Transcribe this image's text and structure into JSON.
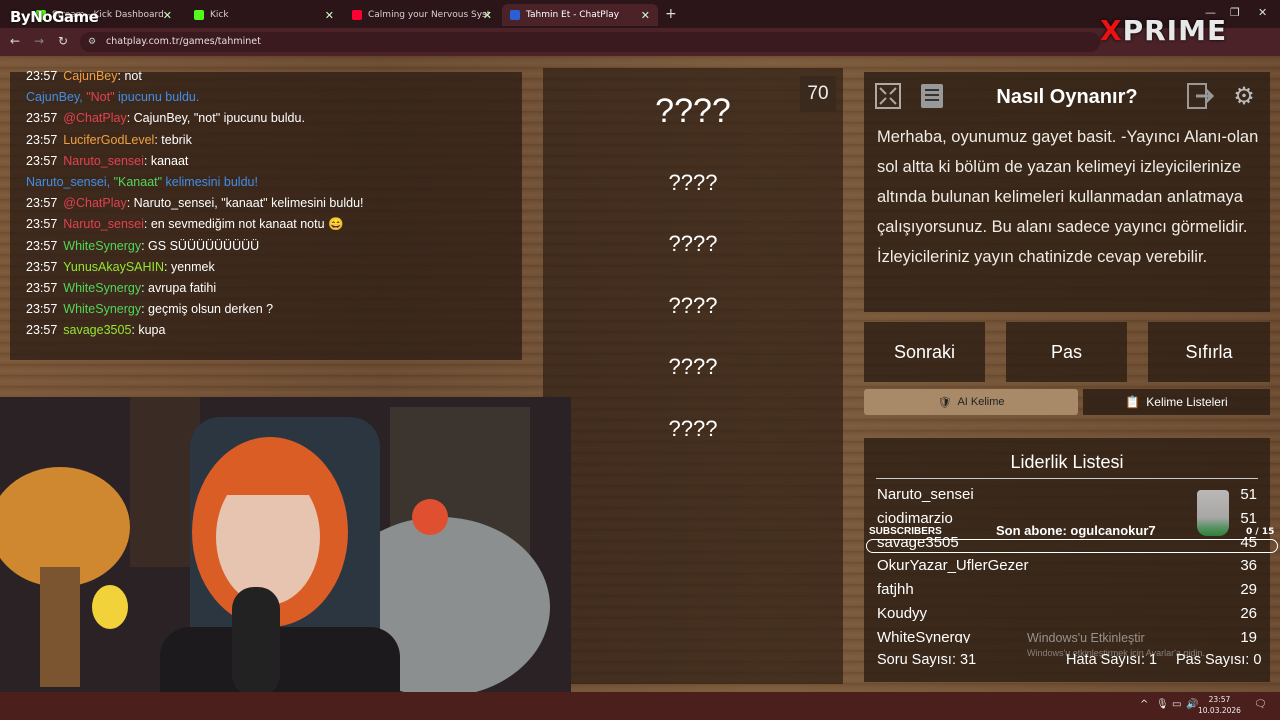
{
  "browser": {
    "tabs": [
      {
        "label": "Stream - Kick Dashboard",
        "fav_color": "#53fc18"
      },
      {
        "label": "Kick",
        "fav_color": "#53fc18"
      },
      {
        "label": "Calming your Nervous Syst",
        "fav_color": "#ff0033"
      },
      {
        "label": "Tahmin Et - ChatPlay",
        "fav_color": "#2a5fd6"
      }
    ],
    "url": "chatplay.com.tr/games/tahminet"
  },
  "overlay": {
    "bynogame_logo": "ByNoGame",
    "prime_logo_x": "X",
    "prime_logo": "PRIME",
    "subscribers_label": "SUBSCRIBERS",
    "last_sub": "Son abone: ogulcanokur7",
    "sub_count": "0 / 15",
    "sub_fraction": 0.0,
    "windows_activate_title": "Windows'u Etkinleştir",
    "windows_activate_sub": "Windows'u etkinleştirmek için Ayarlar'a gidin."
  },
  "chat": [
    {
      "time": "23:57",
      "user": "CajunBey",
      "user_class": "u-orange",
      "msg": "not"
    },
    {
      "time": "",
      "system": true,
      "parts": [
        {
          "t": "CajunBey, ",
          "c": "u-blue"
        },
        {
          "t": "\"Not\"",
          "c": "u-red"
        },
        {
          "t": " ipucunu buldu.",
          "c": "u-blue"
        }
      ]
    },
    {
      "time": "23:57",
      "user": "@ChatPlay",
      "user_class": "u-red",
      "msg": "CajunBey, \"not\" ipucunu buldu."
    },
    {
      "time": "23:57",
      "user": "LuciferGodLevel",
      "user_class": "u-orange",
      "msg": "tebrik"
    },
    {
      "time": "23:57",
      "user": "Naruto_sensei",
      "user_class": "u-red",
      "msg": "kanaat"
    },
    {
      "time": "",
      "system": true,
      "parts": [
        {
          "t": "Naruto_sensei, ",
          "c": "u-blue"
        },
        {
          "t": "\"Kanaat\"",
          "c": "u-green"
        },
        {
          "t": " kelimesini buldu!",
          "c": "u-blue"
        }
      ]
    },
    {
      "time": "23:57",
      "user": "@ChatPlay",
      "user_class": "u-red",
      "msg": "Naruto_sensei, \"kanaat\" kelimesini buldu!"
    },
    {
      "time": "23:57",
      "user": "Naruto_sensei",
      "user_class": "u-red",
      "msg": "en sevmediğim not kanaat notu 😄"
    },
    {
      "time": "23:57",
      "user": "WhiteSynergy",
      "user_class": "u-green",
      "msg": "GS SÜÜÜÜÜÜÜÜÜ"
    },
    {
      "time": "23:57",
      "user": "YunusAkaySAHIN",
      "user_class": "u-lime",
      "msg": "yenmek"
    },
    {
      "time": "23:57",
      "user": "WhiteSynergy",
      "user_class": "u-green",
      "msg": "avrupa fatihi"
    },
    {
      "time": "23:57",
      "user": "WhiteSynergy",
      "user_class": "u-green",
      "msg": "geçmiş olsun derken ?"
    },
    {
      "time": "23:57",
      "user": "savage3505",
      "user_class": "u-lime",
      "msg": "kupa"
    }
  ],
  "game": {
    "timer": "70",
    "answers": [
      "????",
      "????",
      "????",
      "????",
      "????",
      "????"
    ]
  },
  "howto": {
    "title": "Nasıl Oynanır?",
    "body": "Merhaba, oyunumuz gayet basit. -Yayıncı Alanı-olan sol altta ki bölüm de yazan kelimeyi izleyicilerinize altında bulunan kelimeleri kullanmadan anlatmaya çalışıyorsunuz. Bu alanı sadece yayıncı görmelidir. İzleyicileriniz yayın chatinizde cevap verebilir."
  },
  "buttons": {
    "next": "Sonraki",
    "pass": "Pas",
    "reset": "Sıfırla",
    "ai_word": "AI Kelime",
    "word_lists": "Kelime Listeleri"
  },
  "leaderboard": {
    "title": "Liderlik Listesi",
    "rows": [
      {
        "name": "Naruto_sensei",
        "score": "51"
      },
      {
        "name": "ciodimarzio",
        "score": "51"
      },
      {
        "name": "savage3505",
        "score": "45"
      },
      {
        "name": "OkurYazar_UflerGezer",
        "score": "36"
      },
      {
        "name": "fatjhh",
        "score": "29"
      },
      {
        "name": "Koudyy",
        "score": "26"
      },
      {
        "name": "WhiteSynergy",
        "score": "19"
      }
    ],
    "question_count": "Soru Sayısı: 31",
    "error_count": "Hata Sayısı: 1",
    "pass_count": "Pas Sayısı: 0"
  },
  "taskbar": {
    "time": "23:57",
    "date": "10.03.2026"
  }
}
